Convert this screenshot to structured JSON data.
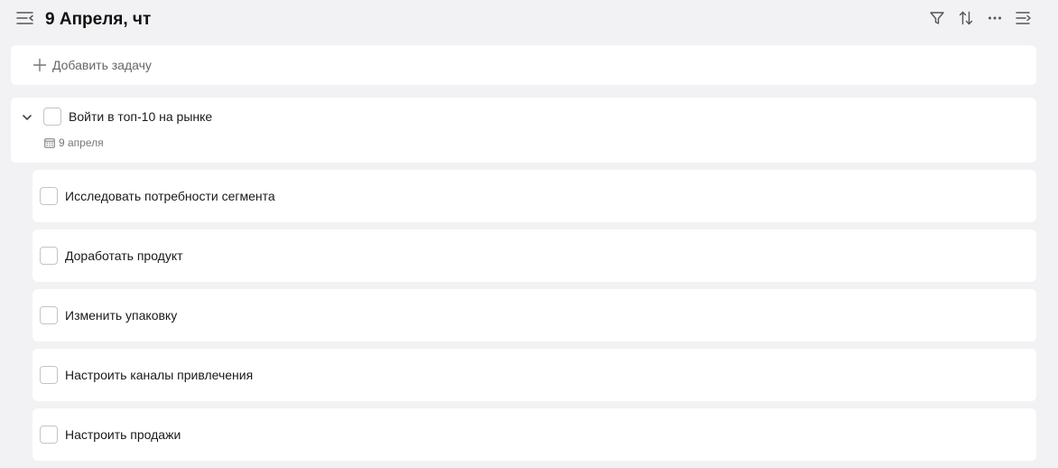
{
  "header": {
    "title": "9 Апреля, чт",
    "icons": [
      "menu-collapse-icon",
      "filter-icon",
      "sort-icon",
      "more-icon",
      "list-view-icon"
    ]
  },
  "add_task": {
    "label": "Добавить задачу",
    "icon": "plus-icon"
  },
  "parent_task": {
    "title": "Войти в топ-10 на рынке",
    "date": "9 апреля",
    "expanded": true
  },
  "subtasks": [
    {
      "title": "Исследовать потребности сегмента"
    },
    {
      "title": "Доработать продукт"
    },
    {
      "title": "Изменить упаковку"
    },
    {
      "title": "Настроить каналы привлечения"
    },
    {
      "title": "Настроить продажи"
    }
  ],
  "colors": {
    "background": "#f2f2f4",
    "card": "#ffffff",
    "checkbox_border": "#c4c4c8",
    "icon": "#555555"
  }
}
